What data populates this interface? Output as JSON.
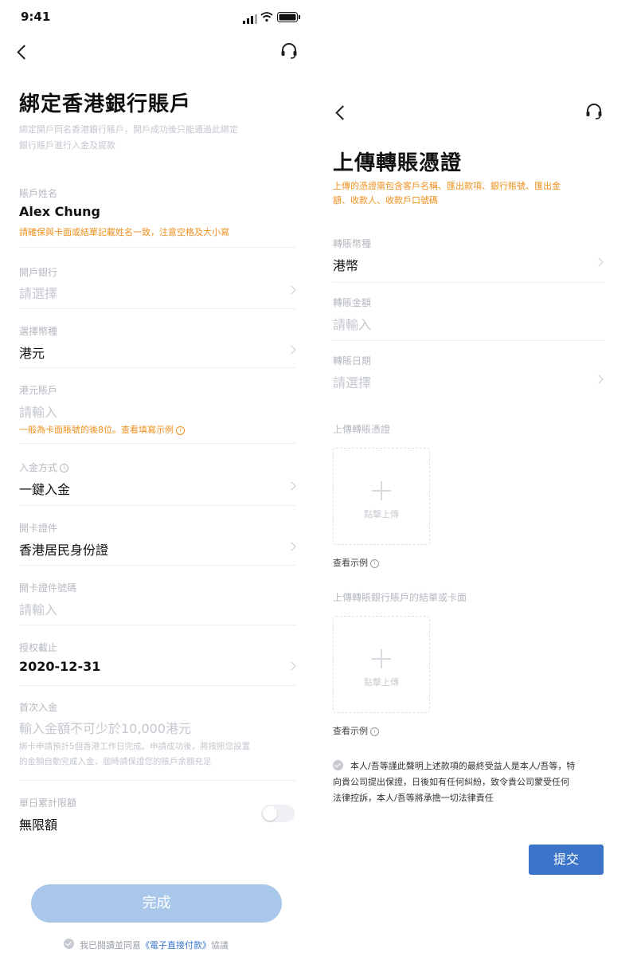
{
  "status_bar": {
    "time": "9:41"
  },
  "left": {
    "title": "綁定香港銀行賬戶",
    "subtitle_line1": "綁定開戶同名香港銀行賬戶，開戶成功後只能通過此綁定",
    "subtitle_line2": "銀行賬戶進行入金及提款",
    "fields": {
      "name_label": "賬戶姓名",
      "name_value": "Alex Chung",
      "name_hint": "請確保與卡面或結單記載姓名一致，注意空格及大小寫",
      "bank_label": "開戶銀行",
      "bank_placeholder": "請選擇",
      "currency_label": "選擇幣種",
      "currency_value": "港元",
      "account_label": "港元賬戶",
      "account_placeholder": "請輸入",
      "account_hint": "一般為卡面賬號的後8位。查看填寫示例",
      "deposit_method_label": "入金方式",
      "deposit_method_value": "一鍵入金",
      "id_doc_label": "開卡證件",
      "id_doc_value": "香港居民身份證",
      "id_no_label": "開卡證件號碼",
      "id_no_placeholder": "請輸入",
      "auth_label": "授权截止",
      "auth_value": "2020-12-31",
      "first_deposit_label": "首次入金",
      "first_deposit_placeholder": "輸入金額不可少於10,000港元",
      "first_deposit_note_line1": "綁卡申請預計5個香港工作日完成。申請成功後，將按照您設置",
      "first_deposit_note_line2": "的金額自動完成入金，屆時請保證您的賬戶余額充足",
      "daily_limit_label": "單日累計限額",
      "daily_limit_value": "無限額"
    },
    "done_button": "完成",
    "agreement_prefix": "我已閱讀並同意",
    "agreement_link": "《電子直接付款》",
    "agreement_suffix": "協議"
  },
  "right": {
    "title": "上傳轉賬憑證",
    "subtitle_line1": "上傳的憑證需包含客戶名稱、匯出款項、銀行賬號、匯出金",
    "subtitle_line2": "額、收款人、收款戶口號碼",
    "fields": {
      "currency_label": "轉賬幣種",
      "currency_value": "港幣",
      "amount_label": "轉賬金額",
      "amount_placeholder": "請輸入",
      "date_label": "轉賬日期",
      "date_placeholder": "請選擇",
      "upload1_label": "上傳轉賬憑證",
      "upload2_label": "上傳轉賬銀行賬戶的結單或卡面",
      "upload_text": "點擊上傳",
      "example_link": "查看示例"
    },
    "declaration_line1": "本人/吾等謹此聲明上述款項的最終受益人是本人/吾等，特",
    "declaration_line2": "向貴公司提出保證，日後如有任何糾紛，致令貴公司蒙受任何",
    "declaration_line3": "法律控訴，本人/吾等將承擔一切法律責任",
    "submit_button": "提交"
  },
  "colors": {
    "accent": "#3b74c9",
    "hint": "#f0901e",
    "done_button": "#a9c7ea"
  }
}
